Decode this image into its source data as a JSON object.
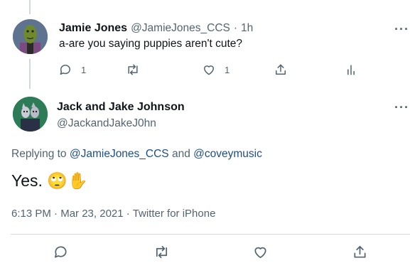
{
  "reply_tweet": {
    "name": "Jamie Jones",
    "handle": "@JamieJones_CCS",
    "separator": "·",
    "time": "1h",
    "text": "a-are you saying puppies aren't cute?",
    "reply_count": "1",
    "like_count": "1"
  },
  "main_tweet": {
    "name": "Jack and Jake Johnson",
    "handle": "@JackandJakeJ0hn",
    "replying_prefix": "Replying to",
    "replying_user1": "@JamieJones_CCS",
    "replying_and": "and",
    "replying_user2": "@coveymusic",
    "text": "Yes.",
    "emojis": "🙄✋",
    "time": "6:13 PM",
    "dot": "·",
    "date": "Mar 23, 2021",
    "source": "Twitter for iPhone"
  },
  "more_label": "···",
  "icons": [
    "reply-icon",
    "retweet-icon",
    "like-icon",
    "share-icon",
    "analytics-icon",
    "more-icon"
  ]
}
